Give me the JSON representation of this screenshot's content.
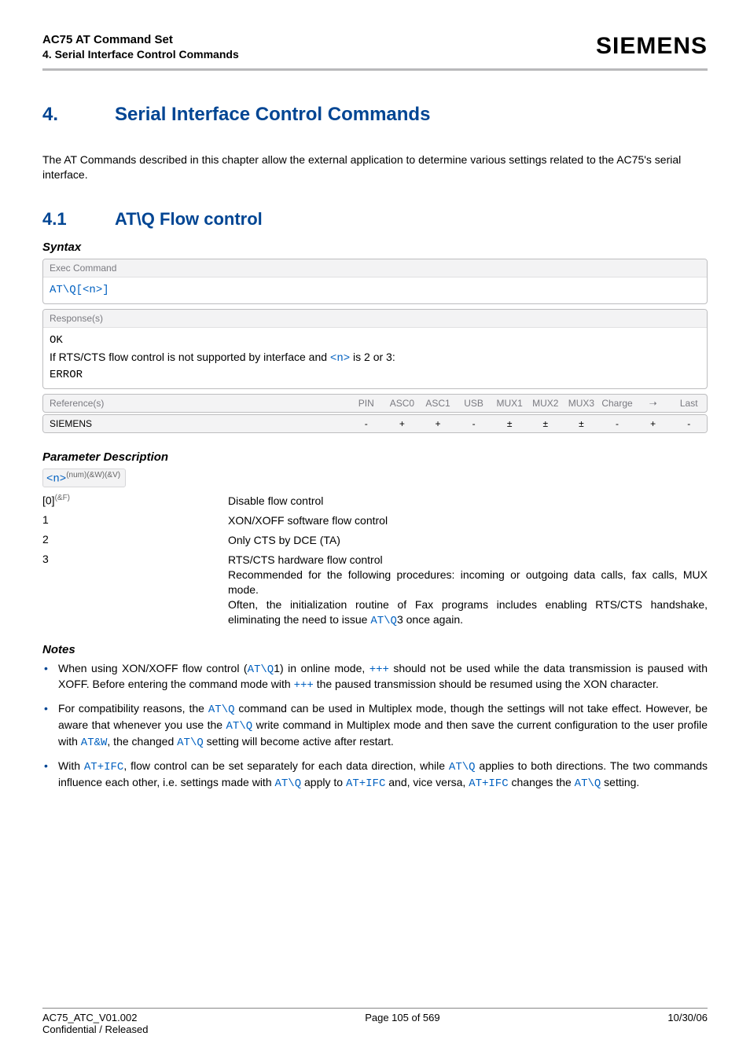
{
  "header": {
    "title": "AC75 AT Command Set",
    "subtitle": "4. Serial Interface Control Commands",
    "brand": "SIEMENS"
  },
  "chapter": {
    "num": "4.",
    "title": "Serial Interface Control Commands",
    "intro": "The AT Commands described in this chapter allow the external application to determine various settings related to the AC75's serial interface."
  },
  "section": {
    "num": "4.1",
    "title": "AT\\Q   Flow control"
  },
  "syntax": {
    "heading": "Syntax",
    "exec_label": "Exec Command",
    "exec_cmd_prefix": "AT\\Q[",
    "exec_cmd_param": "<n>",
    "exec_cmd_suffix": "]",
    "resp_label": "Response(s)",
    "resp_ok": "OK",
    "resp_cond_a": "If RTS/CTS flow control is not supported by interface and ",
    "resp_cond_param": "<n>",
    "resp_cond_b": " is 2 or 3:",
    "resp_error": "ERROR"
  },
  "reference": {
    "label": "Reference(s)",
    "cols": [
      "PIN",
      "ASC0",
      "ASC1",
      "USB",
      "MUX1",
      "MUX2",
      "MUX3",
      "Charge",
      "➝",
      "Last"
    ],
    "row_label": "SIEMENS",
    "row_vals": [
      "-",
      "+",
      "+",
      "-",
      "±",
      "±",
      "±",
      "-",
      "+",
      "-"
    ]
  },
  "params": {
    "heading": "Parameter Description",
    "tag": "<n>",
    "tag_sup": "(num)(&W)(&V)",
    "rows": [
      {
        "k": "[0]",
        "ksup": "(&F)",
        "v": "Disable flow control"
      },
      {
        "k": "1",
        "ksup": "",
        "v": "XON/XOFF software flow control"
      },
      {
        "k": "2",
        "ksup": "",
        "v": "Only CTS by DCE (TA)"
      },
      {
        "k": "3",
        "ksup": "",
        "v_pre": "RTS/CTS hardware flow control\nRecommended for the following procedures: incoming or outgoing data calls, fax calls, MUX mode.\nOften, the initialization routine of Fax programs includes enabling RTS/CTS handshake, eliminating the need to issue ",
        "v_link": "AT\\Q",
        "v_post": "3 once again."
      }
    ]
  },
  "notes": {
    "heading": "Notes",
    "n1_a": "When using XON/XOFF flow control (",
    "n1_l1": "AT\\Q",
    "n1_b": "1) in online mode, ",
    "n1_l2": "+++",
    "n1_c": " should not be used while the data transmission is paused with XOFF. Before entering the command mode with ",
    "n1_l3": "+++",
    "n1_d": " the paused transmission should be resumed using the XON character.",
    "n2_a": "For compatibility reasons, the ",
    "n2_l1": "AT\\Q",
    "n2_b": " command can be used in Multiplex mode, though the settings will not take effect. However, be aware that whenever you use the ",
    "n2_l2": "AT\\Q",
    "n2_c": " write command in Multiplex mode and then save the current configuration to the user profile with ",
    "n2_l3": "AT&W",
    "n2_d": ", the changed ",
    "n2_l4": "AT\\Q",
    "n2_e": " setting will become active after restart.",
    "n3_a": "With ",
    "n3_l1": "AT+IFC",
    "n3_b": ", flow control can be set separately for each data direction, while ",
    "n3_l2": "AT\\Q",
    "n3_c": " applies to both directions. The two commands influence each other, i.e. settings made with ",
    "n3_l3": "AT\\Q",
    "n3_d": " apply to ",
    "n3_l4": "AT+IFC",
    "n3_e": " and, vice versa, ",
    "n3_l5": "AT+IFC",
    "n3_f": " changes the ",
    "n3_l6": "AT\\Q",
    "n3_g": " setting."
  },
  "footer": {
    "left1": "AC75_ATC_V01.002",
    "center": "Page 105 of 569",
    "right": "10/30/06",
    "left2": "Confidential / Released"
  }
}
